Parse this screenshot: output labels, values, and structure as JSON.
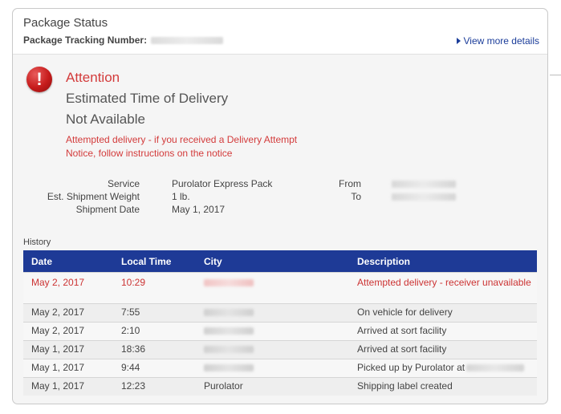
{
  "header": {
    "title": "Package Status",
    "tracking_label": "Package Tracking Number:",
    "view_more": "View more details"
  },
  "alert": {
    "icon": "exclamation-icon",
    "heading": "Attention",
    "eta_title": "Estimated Time of Delivery",
    "eta_value": "Not Available",
    "message": "Attempted delivery - if you received a Delivery Attempt Notice, follow instructions on the notice"
  },
  "details": {
    "service_label": "Service",
    "service_value": "Purolator Express Pack",
    "weight_label": "Est. Shipment Weight",
    "weight_value": "1 lb.",
    "date_label": "Shipment Date",
    "date_value": "May 1, 2017",
    "from_label": "From",
    "to_label": "To"
  },
  "history": {
    "label": "History",
    "columns": [
      "Date",
      "Local Time",
      "City",
      "Description"
    ],
    "rows": [
      {
        "date": "May 2, 2017",
        "time": "10:29",
        "city": "",
        "description": "Attempted delivery - receiver unavailable"
      },
      {
        "date": "May 2, 2017",
        "time": "7:55",
        "city": "",
        "description": "On vehicle for delivery"
      },
      {
        "date": "May 2, 2017",
        "time": "2:10",
        "city": "",
        "description": "Arrived at sort facility"
      },
      {
        "date": "May 1, 2017",
        "time": "18:36",
        "city": "",
        "description": "Arrived at sort facility"
      },
      {
        "date": "May 1, 2017",
        "time": "9:44",
        "city": "",
        "description": "Picked up by Purolator at"
      },
      {
        "date": "May 1, 2017",
        "time": "12:23",
        "city": "Purolator",
        "description": "Shipping label created"
      }
    ]
  },
  "colors": {
    "header_bar": "#1e3a96",
    "alert_red": "#d33b3b",
    "link_blue": "#1b3d9a"
  }
}
